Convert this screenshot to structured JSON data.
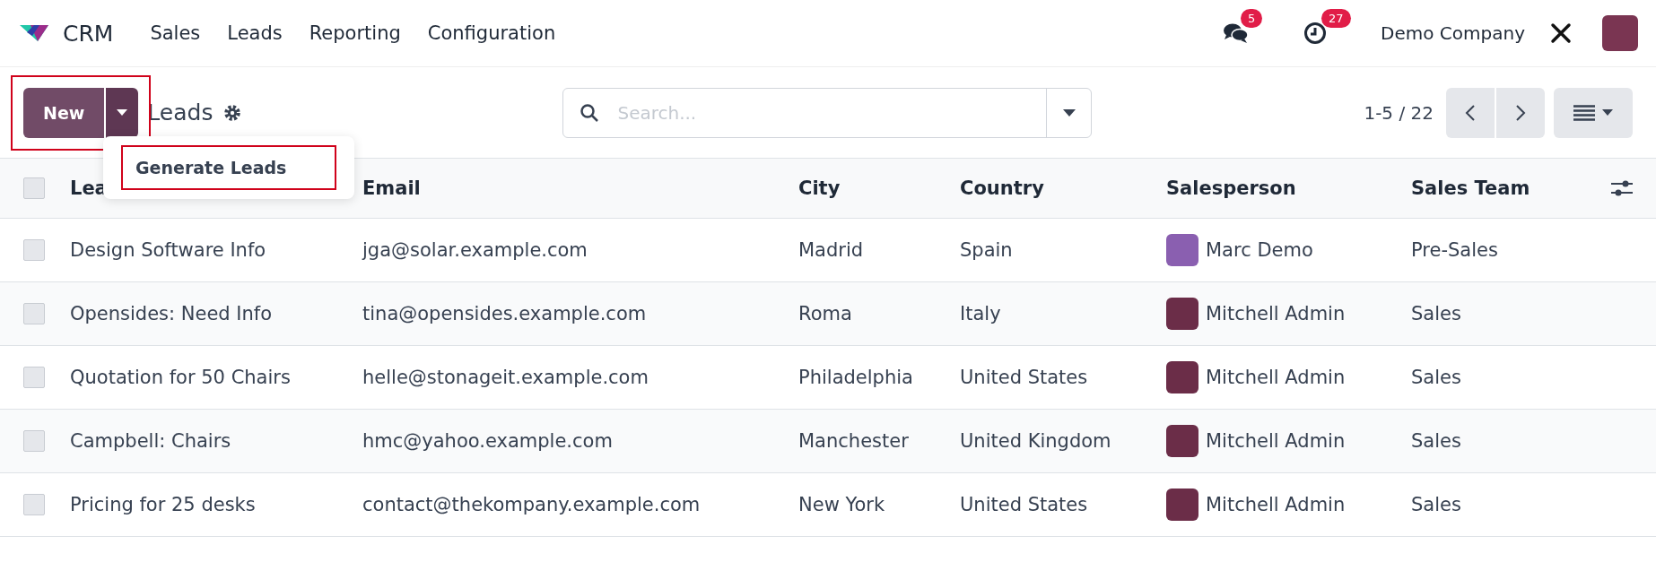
{
  "navbar": {
    "app_name": "CRM",
    "menu": [
      "Sales",
      "Leads",
      "Reporting",
      "Configuration"
    ],
    "messages_badge": "5",
    "activities_badge": "27",
    "company": "Demo Company"
  },
  "control_panel": {
    "new_button": {
      "label": "New",
      "highlighted": true
    },
    "new_menu": {
      "expanded": true,
      "items": [
        {
          "label": "Generate Leads",
          "highlighted": true
        }
      ]
    },
    "title": "Leads",
    "search": {
      "placeholder": "Search..."
    },
    "pager": "1-5 / 22"
  },
  "table": {
    "select_all_checked": false,
    "columns": [
      "Lea",
      "Email",
      "City",
      "Country",
      "Salesperson",
      "Sales Team"
    ],
    "rows": [
      {
        "checked": false,
        "cells": [
          "Design Software Info",
          "jga@solar.example.com",
          "Madrid",
          "Spain"
        ],
        "salesperson": {
          "name": "Marc Demo",
          "color": "#8a5fb0"
        },
        "team": "Pre-Sales"
      },
      {
        "checked": false,
        "cells": [
          "Opensides: Need Info",
          "tina@opensides.example.com",
          "Roma",
          "Italy"
        ],
        "salesperson": {
          "name": "Mitchell Admin",
          "color": "#6b2d48"
        },
        "team": "Sales"
      },
      {
        "checked": false,
        "cells": [
          "Quotation for 50 Chairs",
          "helle@stonageit.example.com",
          "Philadelphia",
          "United States"
        ],
        "salesperson": {
          "name": "Mitchell Admin",
          "color": "#6b2d48"
        },
        "team": "Sales"
      },
      {
        "checked": false,
        "cells": [
          "Campbell: Chairs",
          "hmc@yahoo.example.com",
          "Manchester",
          "United Kingdom"
        ],
        "salesperson": {
          "name": "Mitchell Admin",
          "color": "#6b2d48"
        },
        "team": "Sales"
      },
      {
        "checked": false,
        "cells": [
          "Pricing for 25 desks",
          "contact@thekompany.example.com",
          "New York",
          "United States"
        ],
        "salesperson": {
          "name": "Mitchell Admin",
          "color": "#6b2d48"
        },
        "team": "Sales"
      }
    ]
  }
}
